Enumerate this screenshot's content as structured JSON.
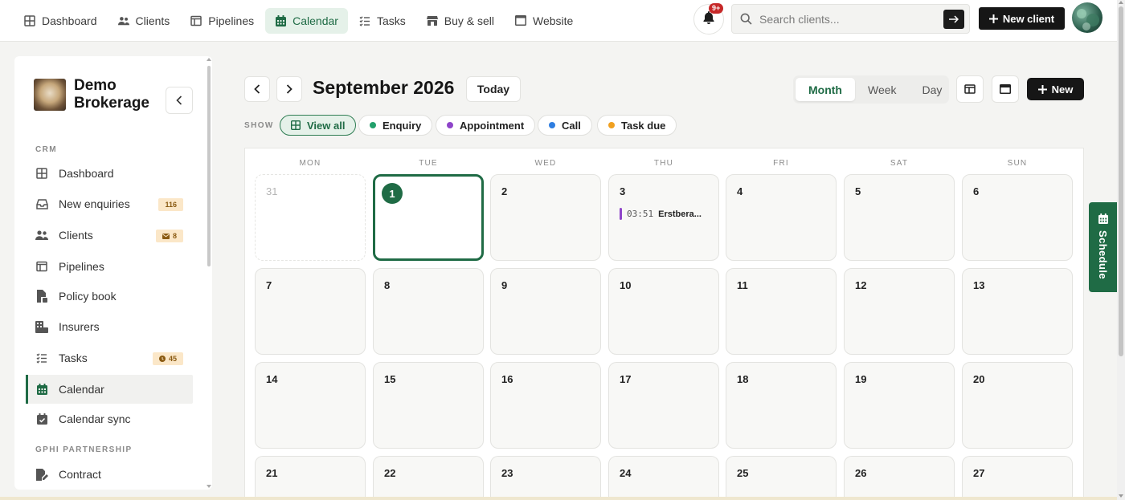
{
  "nav": {
    "items": [
      {
        "label": "Dashboard",
        "icon": "dashboard-icon"
      },
      {
        "label": "Clients",
        "icon": "users-icon"
      },
      {
        "label": "Pipelines",
        "icon": "pipeline-icon"
      },
      {
        "label": "Calendar",
        "icon": "calendar-icon",
        "active": true
      },
      {
        "label": "Tasks",
        "icon": "tasks-icon"
      },
      {
        "label": "Buy & sell",
        "icon": "store-icon"
      },
      {
        "label": "Website",
        "icon": "browser-icon"
      }
    ],
    "notification_badge": "9+",
    "search_placeholder": "Search clients...",
    "new_client_label": "New client"
  },
  "sidebar": {
    "brand_name": "Demo Brokerage",
    "section_crm": "CRM",
    "section_partnership": "GPHI PARTNERSHIP",
    "items": [
      {
        "label": "Dashboard",
        "icon": "dashboard-icon"
      },
      {
        "label": "New enquiries",
        "icon": "inbox-icon",
        "badge": "116"
      },
      {
        "label": "Clients",
        "icon": "users-icon",
        "badge": "8",
        "badge_icon": "mail-icon"
      },
      {
        "label": "Pipelines",
        "icon": "pipeline-icon"
      },
      {
        "label": "Policy book",
        "icon": "policy-icon"
      },
      {
        "label": "Insurers",
        "icon": "building-icon"
      },
      {
        "label": "Tasks",
        "icon": "tasks-icon",
        "badge": "45",
        "badge_icon": "clock-icon"
      },
      {
        "label": "Calendar",
        "icon": "calendar-icon",
        "active": true
      },
      {
        "label": "Calendar sync",
        "icon": "calendar-check-icon"
      },
      {
        "label": "Contract",
        "icon": "contract-icon"
      }
    ]
  },
  "calendar": {
    "title": "September 2026",
    "today_label": "Today",
    "views": [
      "Month",
      "Week",
      "Day"
    ],
    "active_view": "Month",
    "new_label": "New",
    "show_label": "SHOW",
    "filters": [
      {
        "label": "View all",
        "active": true
      },
      {
        "label": "Enquiry",
        "color": "#22a06b"
      },
      {
        "label": "Appointment",
        "color": "#8e44c9"
      },
      {
        "label": "Call",
        "color": "#2f7ee0"
      },
      {
        "label": "Task due",
        "color": "#f0a020"
      }
    ],
    "weekdays": [
      "MON",
      "TUE",
      "WED",
      "THU",
      "FRI",
      "SAT",
      "SUN"
    ],
    "weeks": [
      [
        "31",
        "1",
        "2",
        "3",
        "4",
        "5",
        "6"
      ],
      [
        "7",
        "8",
        "9",
        "10",
        "11",
        "12",
        "13"
      ],
      [
        "14",
        "15",
        "16",
        "17",
        "18",
        "19",
        "20"
      ],
      [
        "21",
        "22",
        "23",
        "24",
        "25",
        "26",
        "27"
      ]
    ],
    "event": {
      "time": "03:51",
      "title": "Erstbera..."
    }
  },
  "schedule_tab_label": "Schedule",
  "colors": {
    "accent": "#1f6b45",
    "accent_light": "#e5f1e9",
    "appointment": "#8e44c9",
    "badge_bg": "#fbe7c8"
  }
}
